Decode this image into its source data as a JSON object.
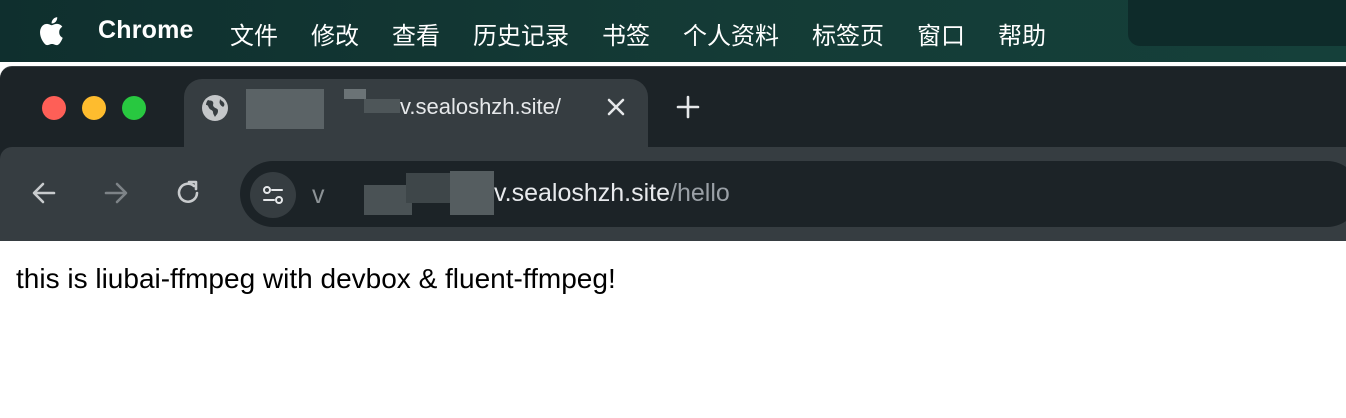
{
  "menubar": {
    "app_name": "Chrome",
    "items": [
      "文件",
      "修改",
      "查看",
      "历史记录",
      "书签",
      "个人资料",
      "标签页",
      "窗口",
      "帮助"
    ]
  },
  "tab": {
    "title_visible": "v.sealoshzh.site/",
    "icon": "globe-icon"
  },
  "omnibox": {
    "url_prefix": "v",
    "url_host_visible": "v.sealoshzh.site",
    "url_path": "/hello"
  },
  "page": {
    "text": "this is liubai-ffmpeg with devbox & fluent-ffmpeg!"
  },
  "colors": {
    "menubar_bg": "#143b36",
    "window_bg": "#1c2327",
    "toolbar_bg": "#363d41",
    "traffic_red": "#fe5f57",
    "traffic_yellow": "#febc2e",
    "traffic_green": "#28c840"
  }
}
